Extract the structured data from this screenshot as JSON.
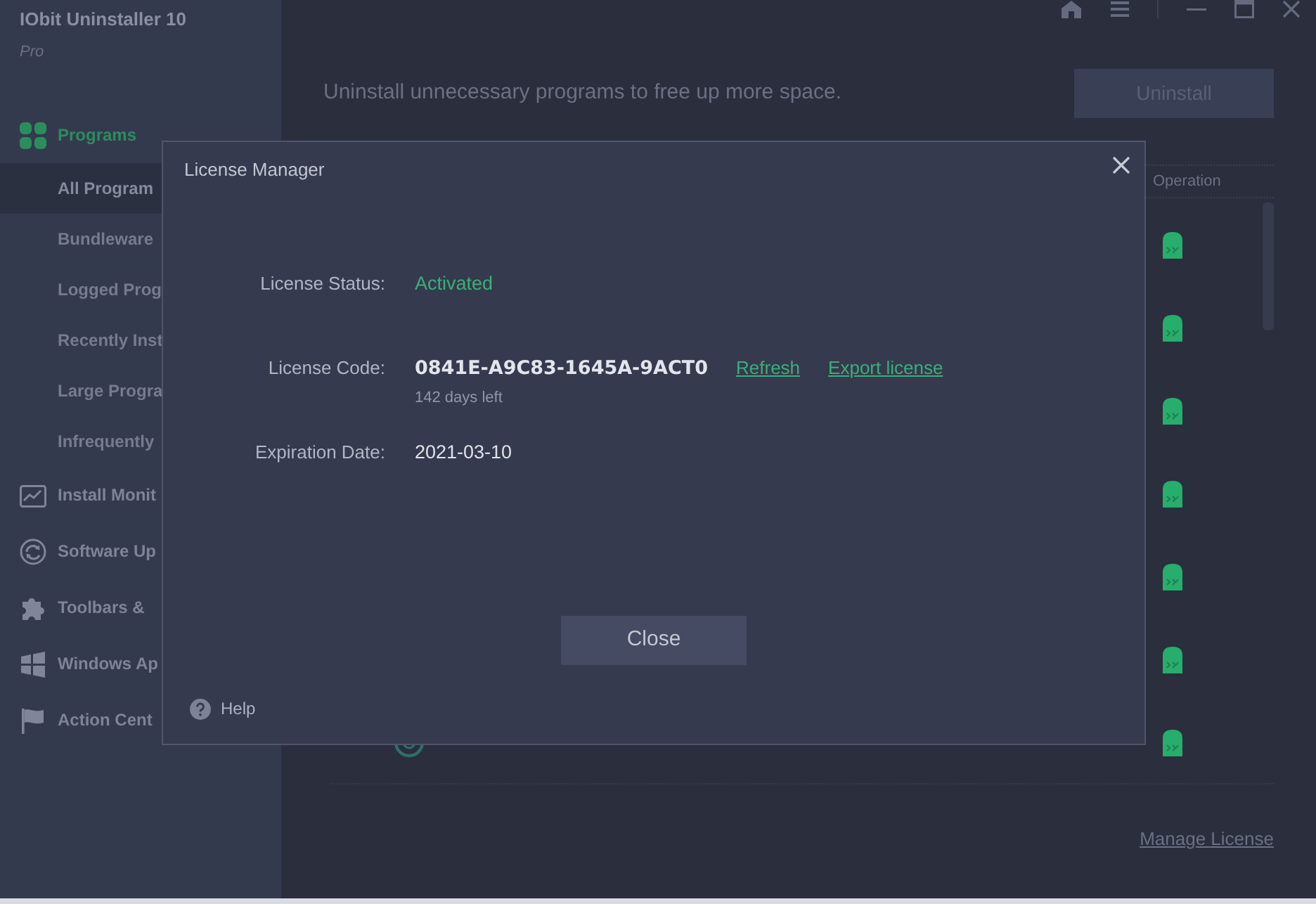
{
  "app": {
    "title": "IObit Uninstaller 10",
    "edition": "Pro"
  },
  "sidebar": {
    "items": [
      {
        "label": "Programs",
        "selected": true,
        "children": [
          {
            "label": "All Program",
            "selected": true
          },
          {
            "label": "Bundleware",
            "selected": false
          },
          {
            "label": "Logged Prog",
            "selected": false
          },
          {
            "label": "Recently Inst",
            "selected": false
          },
          {
            "label": "Large Progra",
            "selected": false
          },
          {
            "label": "Infrequently",
            "selected": false
          }
        ]
      },
      {
        "label": "Install Monit",
        "selected": false
      },
      {
        "label": "Software Up",
        "selected": false
      },
      {
        "label": "Toolbars &",
        "selected": false
      },
      {
        "label": "Windows Ap",
        "selected": false
      },
      {
        "label": "Action Cent",
        "selected": false
      }
    ]
  },
  "content": {
    "tagline": "Uninstall unnecessary programs to free up more space.",
    "uninstall_button": {
      "label": "Uninstall",
      "disabled": true
    },
    "table": {
      "columns": [
        "Operation"
      ]
    },
    "manage_license_link": "Manage License"
  },
  "dialog": {
    "title": "License Manager",
    "fields": [
      {
        "kind": "status",
        "label": "License Status:",
        "value": "Activated"
      },
      {
        "kind": "code",
        "label": "License Code:",
        "value": "0841E-A9C83-1645A-9ACT0",
        "links": [
          "Refresh",
          "Export license"
        ],
        "note": "142 days left"
      },
      {
        "kind": "date",
        "label": "Expiration Date:",
        "value": "2021-03-10"
      }
    ],
    "close_button": "Close",
    "help_link": "Help"
  }
}
